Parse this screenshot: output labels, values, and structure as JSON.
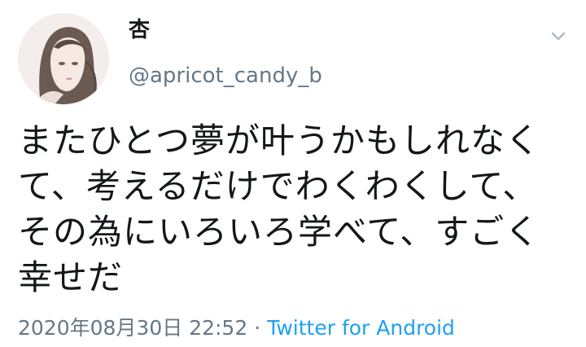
{
  "tweet": {
    "display_name": "杏",
    "handle": "@apricot_candy_b",
    "text": "またひとつ夢が叶うかもしれなく\nて、考えるだけでわくわくして、\nその為にいろいろ学べて、すごく\n幸せだ",
    "timestamp": "2020年08月30日 22:52",
    "separator": "·",
    "source": "Twitter for Android"
  },
  "icons": {
    "menu": "chevron-down-icon",
    "avatar": "avatar"
  },
  "colors": {
    "text": "#14171a",
    "muted": "#657786",
    "link": "#1da1f2",
    "background": "#ffffff"
  }
}
